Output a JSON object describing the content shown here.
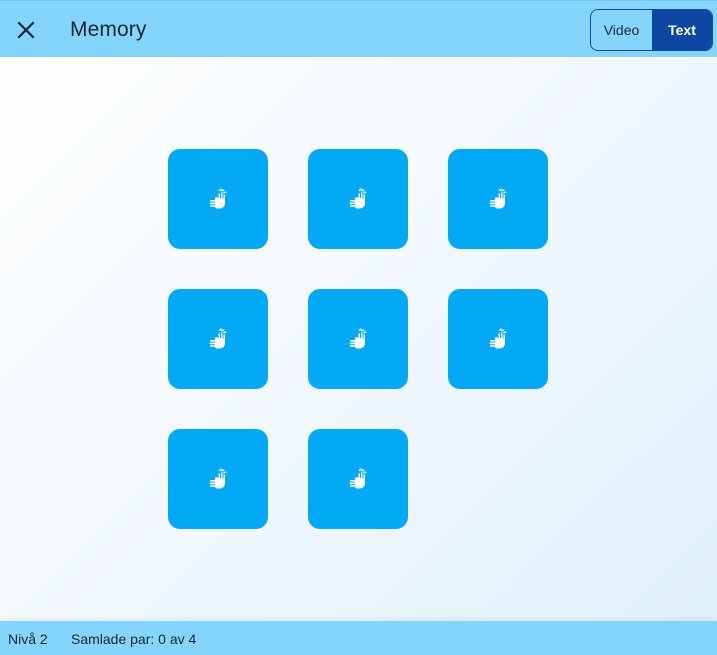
{
  "header": {
    "title": "Memory",
    "close_icon": "close-icon",
    "mode_toggle": {
      "options": [
        "Video",
        "Text"
      ],
      "selected": "Text"
    }
  },
  "board": {
    "card_icon": "sign-language-hand-icon",
    "card_color": "#03a9f4",
    "cards": [
      {
        "state": "face-down"
      },
      {
        "state": "face-down"
      },
      {
        "state": "face-down"
      },
      {
        "state": "face-down"
      },
      {
        "state": "face-down"
      },
      {
        "state": "face-down"
      },
      {
        "state": "face-down"
      },
      {
        "state": "face-down"
      }
    ]
  },
  "footer": {
    "level": "Nivå 2",
    "pairs": "Samlade par: 0 av 4"
  },
  "colors": {
    "bar": "#84d5fb",
    "toggle_active": "#0d47a1",
    "card": "#03a9f4"
  }
}
